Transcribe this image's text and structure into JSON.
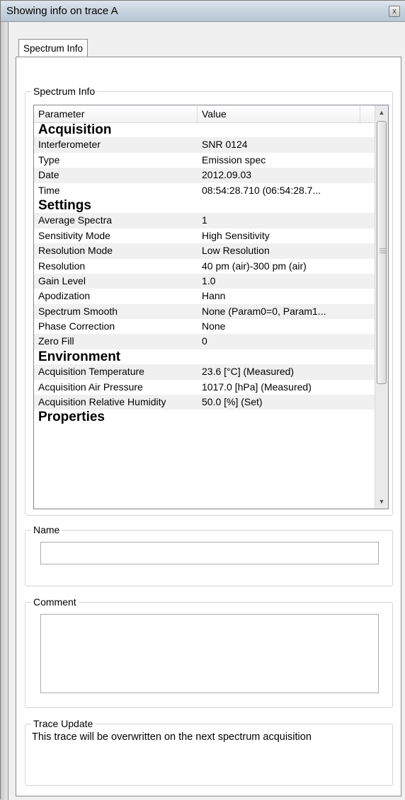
{
  "window": {
    "title": "Showing info on trace A",
    "close_glyph": "x"
  },
  "tab": {
    "label": "Spectrum Info"
  },
  "spectrum_group": {
    "label": "Spectrum Info"
  },
  "grid": {
    "columns": [
      "Parameter",
      "Value"
    ],
    "rows": [
      {
        "type": "section",
        "label": "Acquisition"
      },
      {
        "p": "Interferometer",
        "v": "SNR 0124"
      },
      {
        "p": "Type",
        "v": "Emission spec"
      },
      {
        "p": "Date",
        "v": "2012.09.03"
      },
      {
        "p": "Time",
        "v": "08:54:28.710 (06:54:28.7..."
      },
      {
        "type": "section",
        "label": "Settings"
      },
      {
        "p": "Average Spectra",
        "v": "1"
      },
      {
        "p": "Sensitivity Mode",
        "v": "High Sensitivity"
      },
      {
        "p": "Resolution Mode",
        "v": "Low Resolution"
      },
      {
        "p": "Resolution",
        "v": "40 pm (air)-300 pm (air)"
      },
      {
        "p": "Gain Level",
        "v": "1.0"
      },
      {
        "p": "Apodization",
        "v": "Hann"
      },
      {
        "p": "Spectrum Smooth",
        "v": "None (Param0=0, Param1..."
      },
      {
        "p": "Phase Correction",
        "v": "None"
      },
      {
        "p": "Zero Fill",
        "v": "0"
      },
      {
        "type": "section",
        "label": "Environment"
      },
      {
        "p": "Acquisition Temperature",
        "v": "23.6 [°C] (Measured)"
      },
      {
        "p": "Acquisition Air Pressure",
        "v": "1017.0 [hPa] (Measured)"
      },
      {
        "p": "Acquisition Relative Humidity",
        "v": "50.0 [%] (Set)"
      },
      {
        "type": "section",
        "label": "Properties"
      }
    ]
  },
  "name_group": {
    "label": "Name",
    "value": ""
  },
  "comment_group": {
    "label": "Comment",
    "value": ""
  },
  "trace_update_group": {
    "label": "Trace Update",
    "text": "This trace will be overwritten on the next spectrum acquisition"
  }
}
